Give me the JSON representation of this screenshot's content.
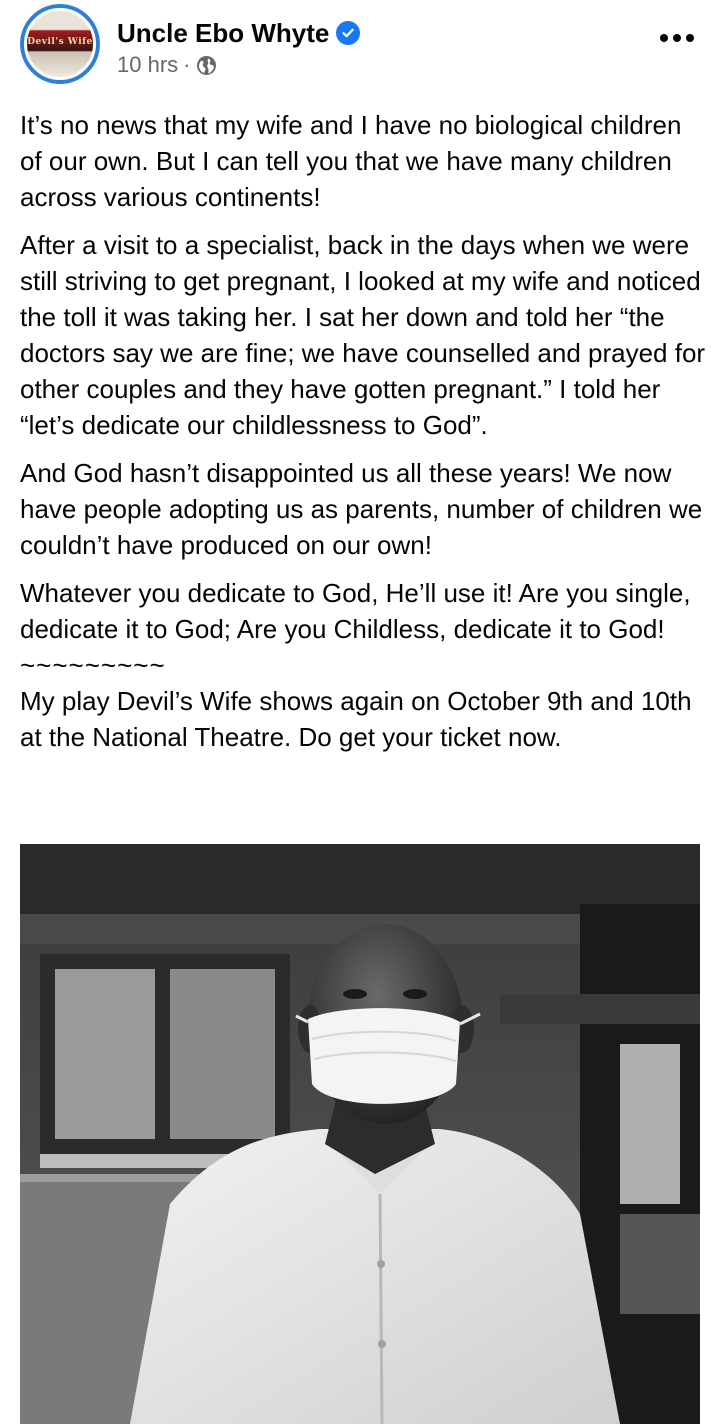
{
  "post": {
    "author": "Uncle Ebo Whyte",
    "time": "10 hrs",
    "separator": "·",
    "avatar_text": "Devil's Wife",
    "paragraphs": [
      "It’s no news that my wife and I have no biological children of our own. But I can tell you that we have many children across various continents!",
      "After a visit to a specialist, back in the days when we were still striving to get pregnant, I looked at my wife and noticed the toll it was taking her. I sat her down and told her “the doctors say we are fine; we have counselled and prayed for other couples and they have gotten pregnant.” I told her “let’s dedicate our childlessness to God”.",
      "And God hasn’t disappointed us all these years! We now have people adopting us as parents, number of children we couldn’t have produced on our own!",
      "Whatever you dedicate to God, He’ll use it! Are you single, dedicate it to God; Are you Childless, dedicate it to God!"
    ],
    "divider": "~~~~~~~~~",
    "closing": "My play Devil’s Wife shows again on October 9th and 10th at the National Theatre. Do get your ticket now."
  },
  "icons": {
    "verified": "verified-badge-icon",
    "privacy": "globe-icon",
    "more": "more-options-icon"
  },
  "colors": {
    "verified": "#1877f2",
    "meta": "#65676b",
    "text": "#050505",
    "avatar_ring": "#2f7fd6"
  }
}
